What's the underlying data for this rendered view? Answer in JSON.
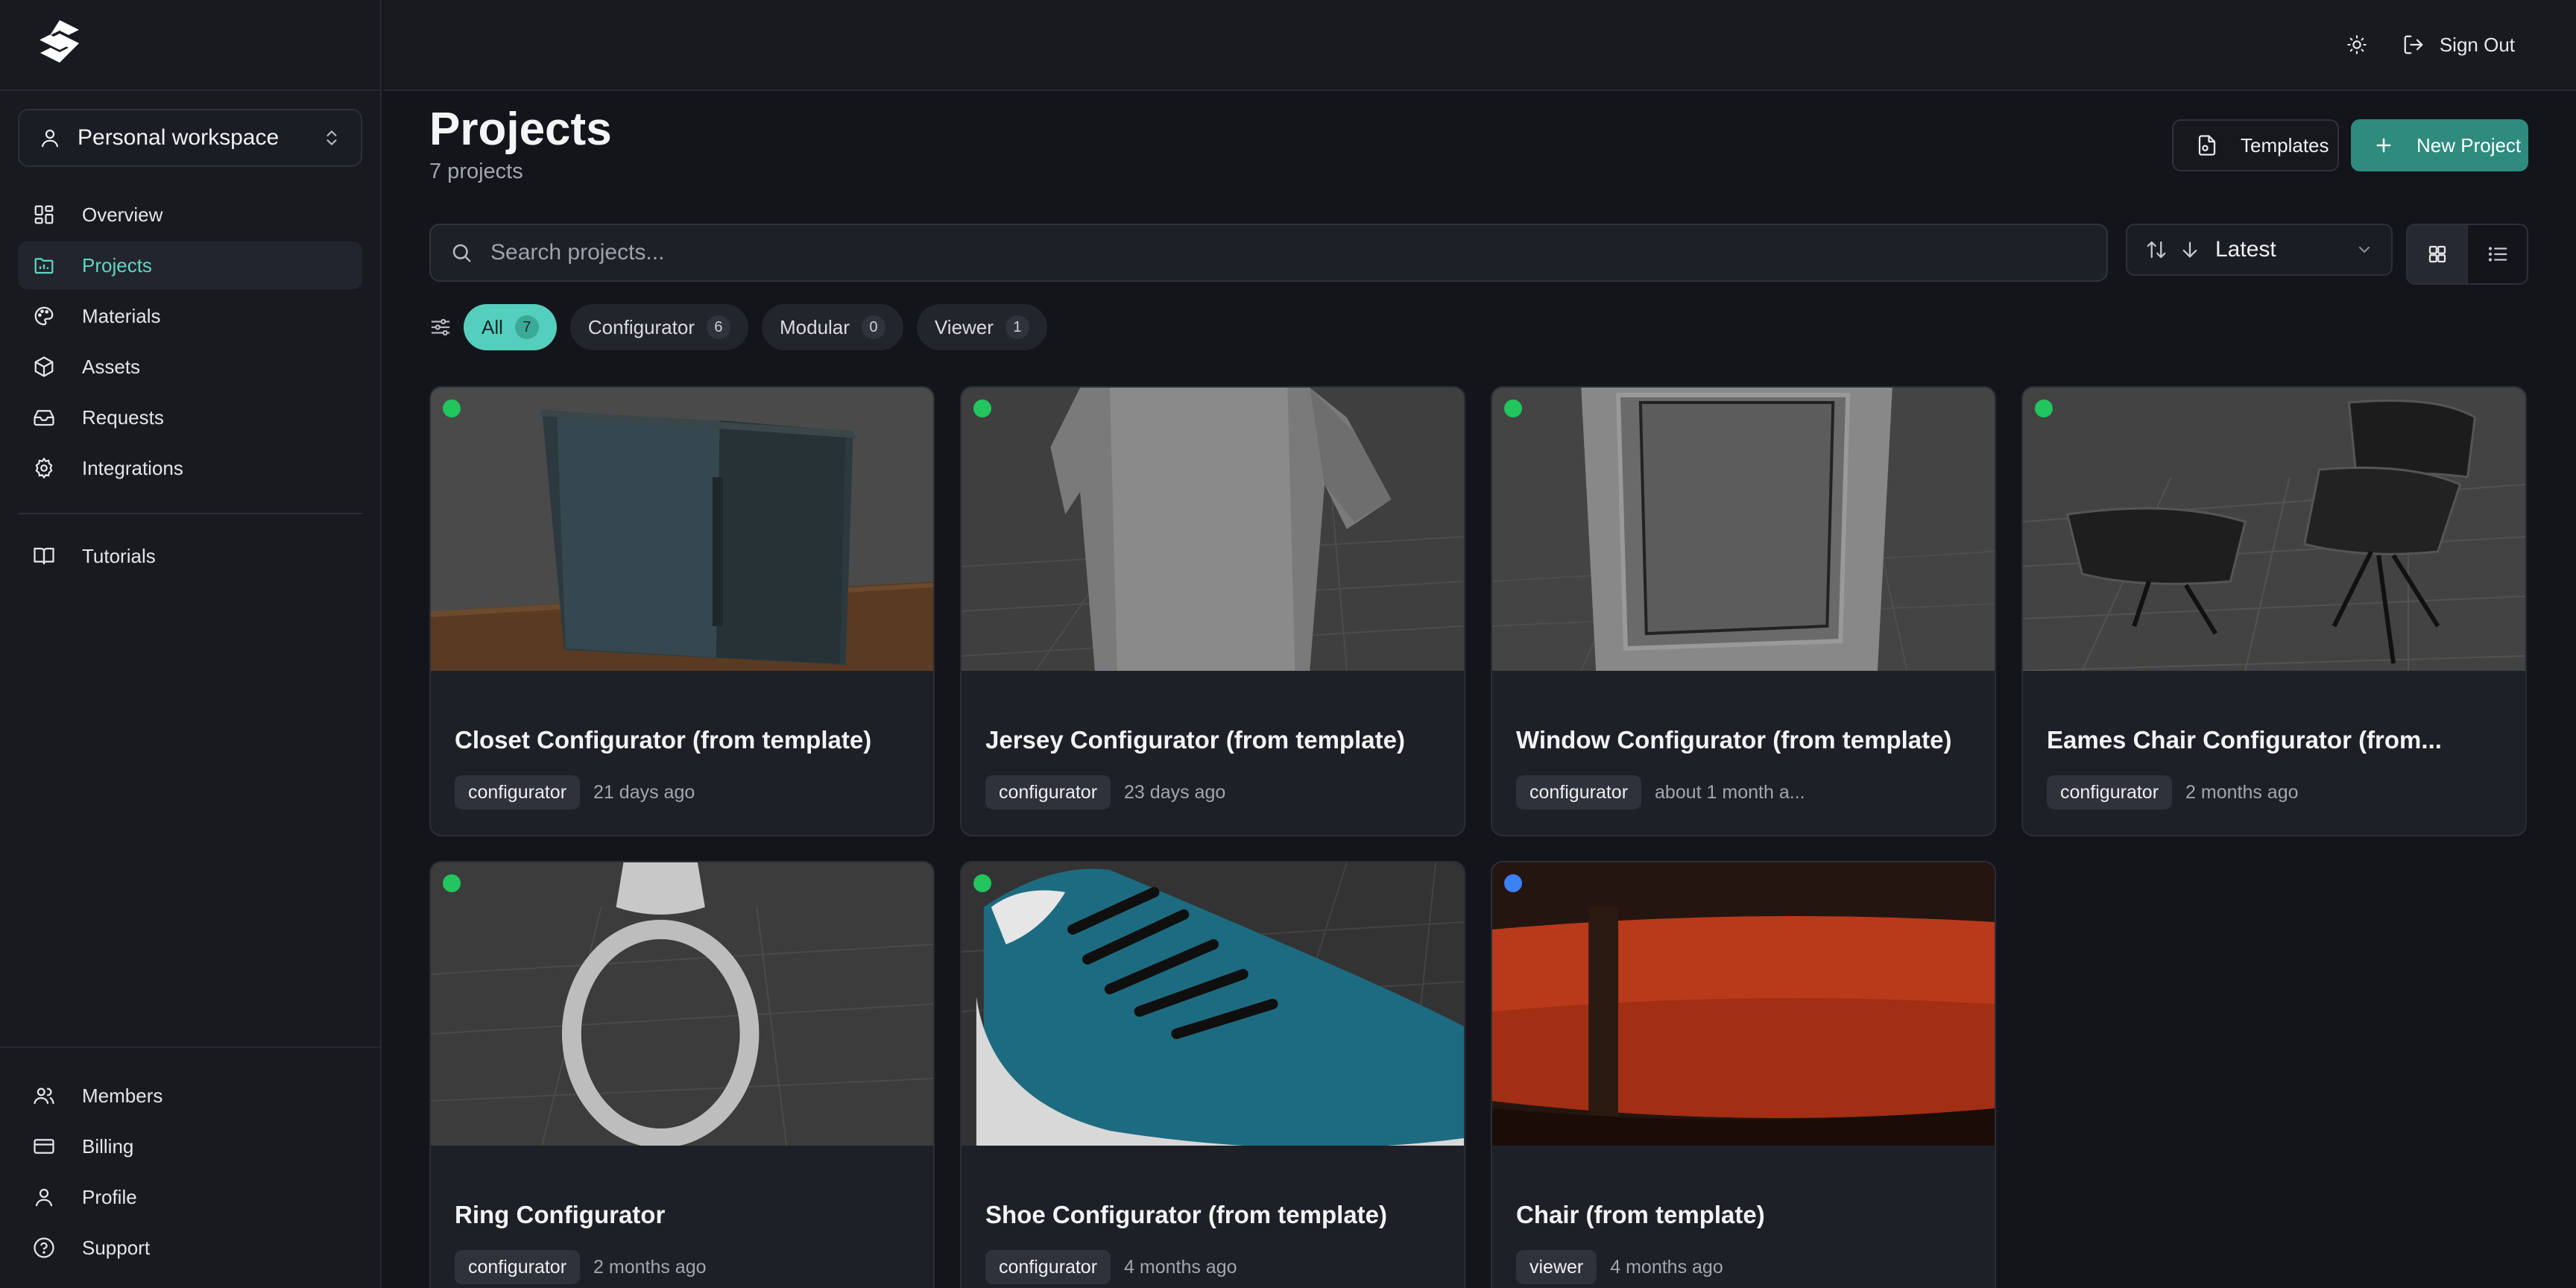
{
  "workspace": {
    "label": "Personal workspace"
  },
  "nav": {
    "items": [
      {
        "label": "Overview",
        "icon": "dashboard-icon"
      },
      {
        "label": "Projects",
        "icon": "folder-icon"
      },
      {
        "label": "Materials",
        "icon": "palette-icon"
      },
      {
        "label": "Assets",
        "icon": "cube-icon"
      },
      {
        "label": "Requests",
        "icon": "inbox-icon"
      },
      {
        "label": "Integrations",
        "icon": "gear-icon"
      }
    ],
    "secondary": [
      {
        "label": "Tutorials",
        "icon": "book-icon"
      }
    ],
    "bottom": [
      {
        "label": "Members",
        "icon": "users-icon"
      },
      {
        "label": "Billing",
        "icon": "credit-card-icon"
      },
      {
        "label": "Profile",
        "icon": "user-icon"
      },
      {
        "label": "Support",
        "icon": "help-circle-icon"
      }
    ]
  },
  "topbar": {
    "sign_out": "Sign Out"
  },
  "page": {
    "title": "Projects",
    "subtitle": "7 projects",
    "templates_label": "Templates",
    "new_project_label": "New Project"
  },
  "search": {
    "placeholder": "Search projects..."
  },
  "sort": {
    "value": "Latest"
  },
  "filters": [
    {
      "label": "All",
      "count": "7"
    },
    {
      "label": "Configurator",
      "count": "6"
    },
    {
      "label": "Modular",
      "count": "0"
    },
    {
      "label": "Viewer",
      "count": "1"
    }
  ],
  "projects": [
    {
      "title": "Closet Configurator (from template)",
      "tag": "configurator",
      "time": "21 days ago",
      "status": "#22c55e"
    },
    {
      "title": "Jersey Configurator (from template)",
      "tag": "configurator",
      "time": "23 days ago",
      "status": "#22c55e"
    },
    {
      "title": "Window Configurator (from template)",
      "tag": "configurator",
      "time": "about 1 month a...",
      "status": "#22c55e"
    },
    {
      "title": "Eames Chair Configurator (from...",
      "tag": "configurator",
      "time": "2 months ago",
      "status": "#22c55e"
    },
    {
      "title": "Ring Configurator",
      "tag": "configurator",
      "time": "2 months ago",
      "status": "#22c55e"
    },
    {
      "title": "Shoe Configurator (from template)",
      "tag": "configurator",
      "time": "4 months ago",
      "status": "#22c55e"
    },
    {
      "title": "Chair (from template)",
      "tag": "viewer",
      "time": "4 months ago",
      "status": "#3b82f6"
    }
  ],
  "colors": {
    "accent": "#5fd6c4",
    "primary_button": "#2e8b7e",
    "background": "#13151b"
  }
}
